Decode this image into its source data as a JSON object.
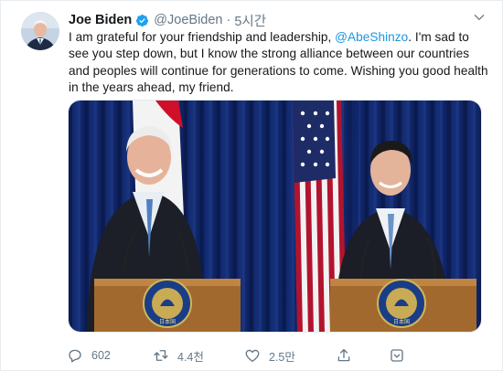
{
  "tweet": {
    "author_name": "Joe Biden",
    "author_handle": "@JoeBiden",
    "separator": "·",
    "timestamp": "5시간",
    "text_before_mention": "I am grateful for your friendship and leadership, ",
    "mention": "@AbeShinzo",
    "text_after_mention": ". I'm sad to see you step down, but I know the strong alliance between our countries and peoples will continue for generations to come. Wishing you good health in the years ahead, my friend.",
    "photo": {
      "description_icon": "photo-joe-biden-shinzo-abe-press-conference",
      "podium_seal_text_left": "日本国",
      "podium_seal_text_right": "日本国"
    }
  },
  "actions": {
    "reply_count": "602",
    "retweet_count": "4.4천",
    "like_count": "2.5만"
  },
  "icons": {
    "verified": "verified-badge-icon",
    "caret": "chevron-down-icon",
    "reply": "reply-icon",
    "retweet": "retweet-icon",
    "like": "like-icon",
    "share": "share-icon",
    "analytics": "analytics-icon"
  },
  "colors": {
    "accent": "#1b95e0",
    "secondary_text": "#657786",
    "primary_text": "#14171a"
  }
}
